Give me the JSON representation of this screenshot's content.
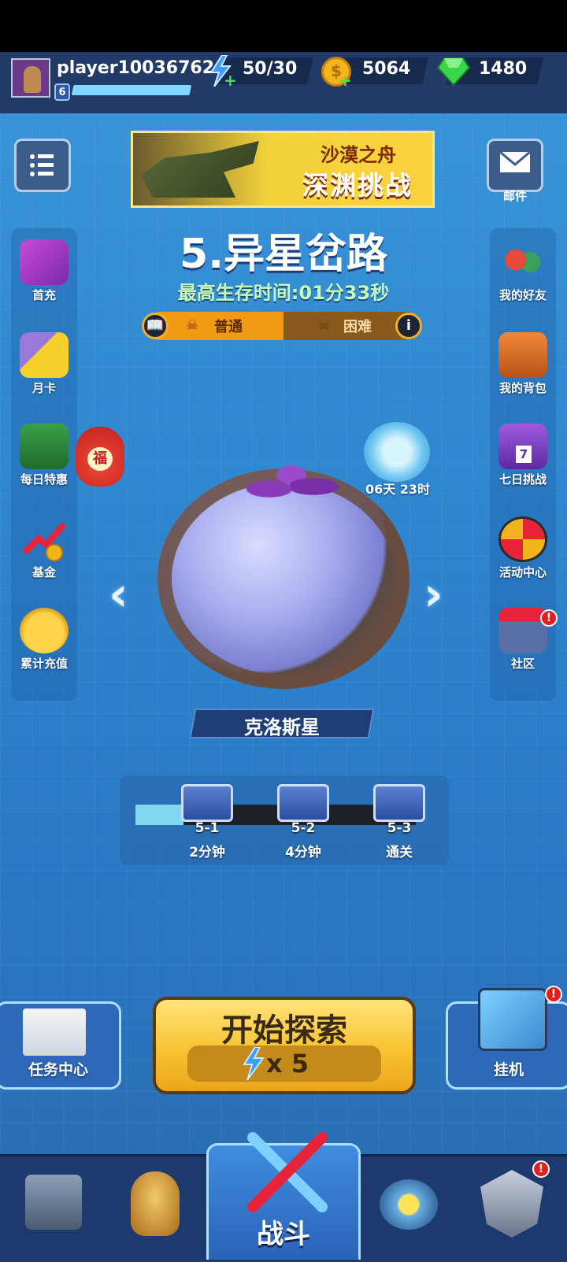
{
  "player": {
    "name": "player10036762",
    "level": "6"
  },
  "resources": {
    "energy": "50/30",
    "gold": "5064",
    "gems": "1480"
  },
  "banner": {
    "line1": "沙漠之舟",
    "line2": "深渊挑战"
  },
  "mail_label": "邮件",
  "left_menu": [
    {
      "label": "首充",
      "icon": "gift-box-icon"
    },
    {
      "label": "月卡",
      "icon": "month-card-icon"
    },
    {
      "label": "每日特惠",
      "icon": "money-chest-icon"
    },
    {
      "label": "基金",
      "icon": "fund-chart-icon"
    },
    {
      "label": "累计充值",
      "icon": "piggy-bank-icon"
    }
  ],
  "lucky_bag_label": "福",
  "right_menu": [
    {
      "label": "我的好友",
      "icon": "friends-icon"
    },
    {
      "label": "我的背包",
      "icon": "backpack-icon"
    },
    {
      "label": "七日挑战",
      "icon": "seven-day-gift-icon",
      "badge": "7"
    },
    {
      "label": "活动中心",
      "icon": "activity-wheel-icon"
    },
    {
      "label": "社区",
      "icon": "community-shop-icon",
      "alert": "!"
    }
  ],
  "stage": {
    "title": "5.异星岔路",
    "best_time": "最高生存时间:01分33秒",
    "difficulty_normal": "普通",
    "difficulty_hard": "困难",
    "info_icon": "i"
  },
  "event_timer": "06天 23时",
  "planet_name": "克洛斯星",
  "milestones": [
    {
      "id": "5-1",
      "req": "2分钟"
    },
    {
      "id": "5-2",
      "req": "4分钟"
    },
    {
      "id": "5-3",
      "req": "通关"
    }
  ],
  "milestone_progress": 0.17,
  "task_center_label": "任务中心",
  "idle_label": "挂机",
  "idle_alert": "!",
  "start_button": {
    "label": "开始探索",
    "cost": "x 5"
  },
  "bottom_nav": {
    "active_label": "战斗",
    "hero_alert": "!"
  },
  "colors": {
    "accent_gold": "#f8c332",
    "energy_blue": "#3aa0ff",
    "alert_red": "#e02020"
  }
}
